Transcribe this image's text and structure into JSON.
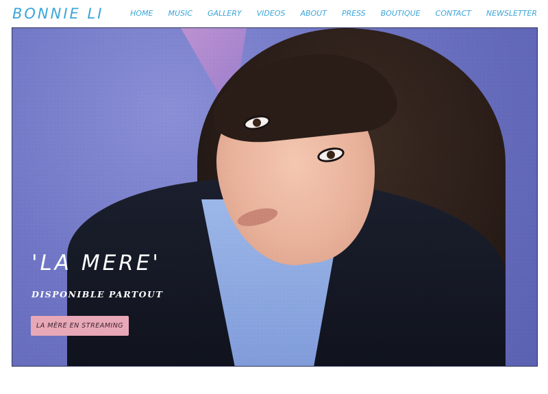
{
  "site": {
    "logo": "BONNIE LI"
  },
  "nav": {
    "items": [
      {
        "label": "HOME"
      },
      {
        "label": "MUSIC"
      },
      {
        "label": "GALLERY"
      },
      {
        "label": "VIDEOS"
      },
      {
        "label": "ABOUT"
      },
      {
        "label": "PRESS"
      },
      {
        "label": "BOUTIQUE"
      },
      {
        "label": "CONTACT"
      },
      {
        "label": "NEWSLETTER"
      }
    ]
  },
  "hero": {
    "title": "'LA MERE'",
    "subtitle": "DISPONIBLE PARTOUT",
    "cta_label": "LA MÈRE EN STREAMING"
  },
  "colors": {
    "accent": "#3aa5d8",
    "hero_background": "#6f75c4",
    "cta_background": "#e8a8b7"
  }
}
